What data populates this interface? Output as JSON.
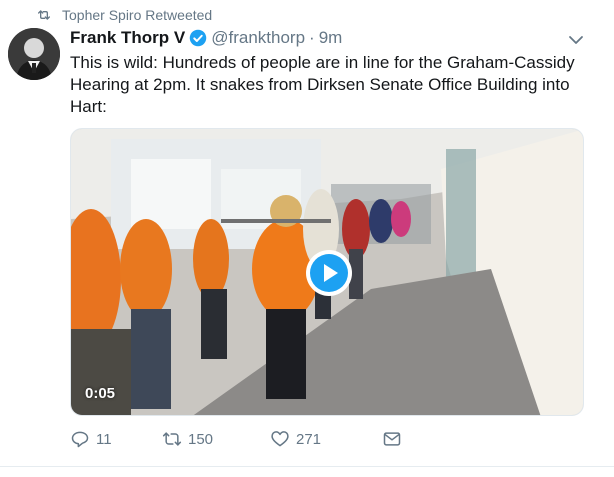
{
  "retweet_banner": {
    "text": "Topher Spiro Retweeted"
  },
  "tweet": {
    "author_name": "Frank Thorp V",
    "handle": "@frankthorp",
    "separator": "·",
    "timestamp": "9m",
    "text": "This is wild: Hundreds of people are in line for the Graham-Cassidy Hearing at 2pm. It snakes from Dirksen Senate Office Building into Hart:",
    "video": {
      "duration": "0:05"
    }
  },
  "actions": {
    "replies": "11",
    "retweets": "150",
    "likes": "271"
  },
  "icons": {
    "retweet_banner": "retweet-icon",
    "verified": "verified-badge-icon",
    "caret": "chevron-down-icon",
    "play": "play-icon",
    "reply": "reply-icon",
    "retweet": "retweet-icon",
    "like": "heart-icon",
    "dm": "envelope-icon"
  },
  "colors": {
    "accent": "#1da1f2",
    "secondary_text": "#657786",
    "primary_text": "#14171a"
  }
}
